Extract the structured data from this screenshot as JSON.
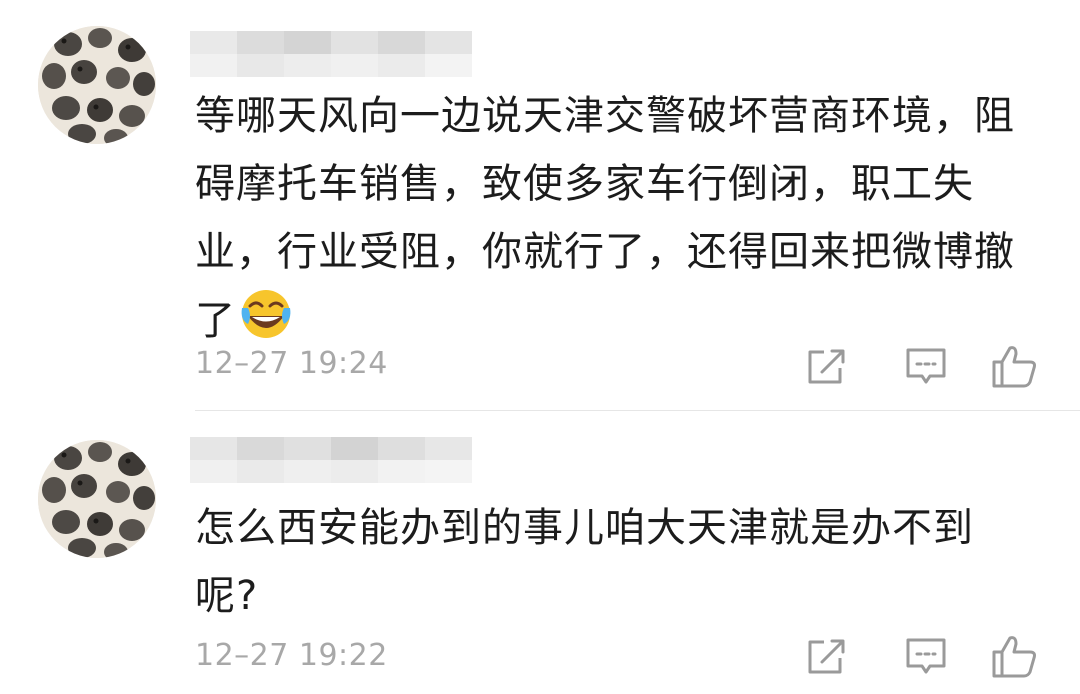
{
  "comments": [
    {
      "username": "",
      "text_lines": [
        "等哪天风向一边说天津交警破坏营商环境，阻",
        "碍摩托车销售，致使多家车行倒闭，职工失",
        "业，行业受阻，你就行了，还得回来把微博撤",
        "了"
      ],
      "emoji": "laugh-cry-emoji",
      "timestamp": "12–27 19:24",
      "actions": {
        "repost_icon": "repost-icon",
        "reply_icon": "reply-icon",
        "like_icon": "thumbs-up-icon"
      }
    },
    {
      "username": "",
      "text_lines": [
        "怎么西安能办到的事儿咱大天津就是办不到",
        "呢?"
      ],
      "timestamp": "12–27 19:22",
      "actions": {
        "repost_icon": "repost-icon",
        "reply_icon": "reply-icon",
        "like_icon": "thumbs-up-icon"
      }
    }
  ],
  "colors": {
    "text": "#1c1c1c",
    "meta": "#a8a8a8",
    "icon": "#9a9a9a",
    "divider": "#e6e6e6",
    "blur_light": "#ececec",
    "blur_dark": "#d2d2d2"
  }
}
